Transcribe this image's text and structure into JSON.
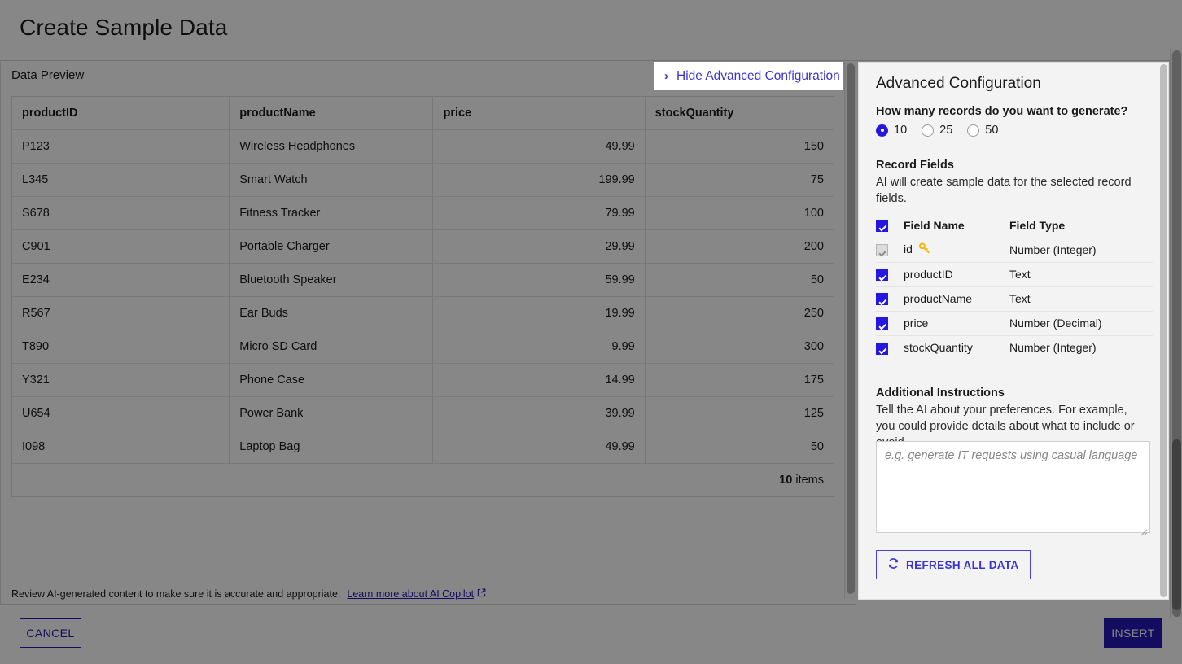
{
  "window": {
    "title": "Create Sample Data"
  },
  "preview": {
    "label": "Data Preview",
    "columns": [
      {
        "key": "productID",
        "label": "productID",
        "align": "left"
      },
      {
        "key": "productName",
        "label": "productName",
        "align": "left"
      },
      {
        "key": "price",
        "label": "price",
        "align": "right"
      },
      {
        "key": "stockQuantity",
        "label": "stockQuantity",
        "align": "right"
      }
    ],
    "rows": [
      {
        "productID": "P123",
        "productName": "Wireless Headphones",
        "price": "49.99",
        "stockQuantity": "150"
      },
      {
        "productID": "L345",
        "productName": "Smart Watch",
        "price": "199.99",
        "stockQuantity": "75"
      },
      {
        "productID": "S678",
        "productName": "Fitness Tracker",
        "price": "79.99",
        "stockQuantity": "100"
      },
      {
        "productID": "C901",
        "productName": "Portable Charger",
        "price": "29.99",
        "stockQuantity": "200"
      },
      {
        "productID": "E234",
        "productName": "Bluetooth Speaker",
        "price": "59.99",
        "stockQuantity": "50"
      },
      {
        "productID": "R567",
        "productName": "Ear Buds",
        "price": "19.99",
        "stockQuantity": "250"
      },
      {
        "productID": "T890",
        "productName": "Micro SD Card",
        "price": "9.99",
        "stockQuantity": "300"
      },
      {
        "productID": "Y321",
        "productName": "Phone Case",
        "price": "14.99",
        "stockQuantity": "175"
      },
      {
        "productID": "U654",
        "productName": "Power Bank",
        "price": "39.99",
        "stockQuantity": "125"
      },
      {
        "productID": "I098",
        "productName": "Laptop Bag",
        "price": "49.99",
        "stockQuantity": "50"
      }
    ],
    "footer": {
      "count": "10",
      "items_label": "items"
    }
  },
  "toggle_advanced": {
    "label": "Hide Advanced Configuration",
    "icon": "chevron-right-icon",
    "accent": "#3b33d1"
  },
  "advanced": {
    "heading": "Advanced Configuration",
    "record_count": {
      "question": "How many records do you want to generate?",
      "options": [
        "10",
        "25",
        "50"
      ],
      "selected": "10"
    },
    "record_fields": {
      "title": "Record Fields",
      "description": "AI will create sample data for the selected record fields.",
      "headers": {
        "select_all": "select-all-checkbox",
        "name": "Field Name",
        "type": "Field Type"
      },
      "select_all_checked": true,
      "rows": [
        {
          "name": "id",
          "type": "Number (Integer)",
          "checked": true,
          "disabled": true,
          "badge": "primary-key-icon"
        },
        {
          "name": "productID",
          "type": "Text",
          "checked": true,
          "disabled": false,
          "badge": ""
        },
        {
          "name": "productName",
          "type": "Text",
          "checked": true,
          "disabled": false,
          "badge": ""
        },
        {
          "name": "price",
          "type": "Number (Decimal)",
          "checked": true,
          "disabled": false,
          "badge": ""
        },
        {
          "name": "stockQuantity",
          "type": "Number (Integer)",
          "checked": true,
          "disabled": false,
          "badge": ""
        }
      ]
    },
    "instructions": {
      "title": "Additional Instructions",
      "description": "Tell the AI about your preferences. For example, you could provide details about what to include or avoid.",
      "placeholder": "e.g. generate IT requests using casual language",
      "value": ""
    },
    "refresh_button": {
      "label": "REFRESH ALL DATA",
      "icon": "refresh-icon"
    }
  },
  "disclaimer": {
    "text": "Review AI-generated content to make sure it is accurate and appropriate.",
    "link_label": "Learn more about AI Copilot",
    "link_icon": "external-link-icon"
  },
  "actions": {
    "cancel_label": "CANCEL",
    "insert_label": "INSERT"
  },
  "colors": {
    "accent_blue": "#2417b8",
    "link_blue": "#3b33d1",
    "checkbox_blue": "#2417e0",
    "key_yellow": "#f2b90c",
    "panel_bg": "#f3f3f3"
  }
}
